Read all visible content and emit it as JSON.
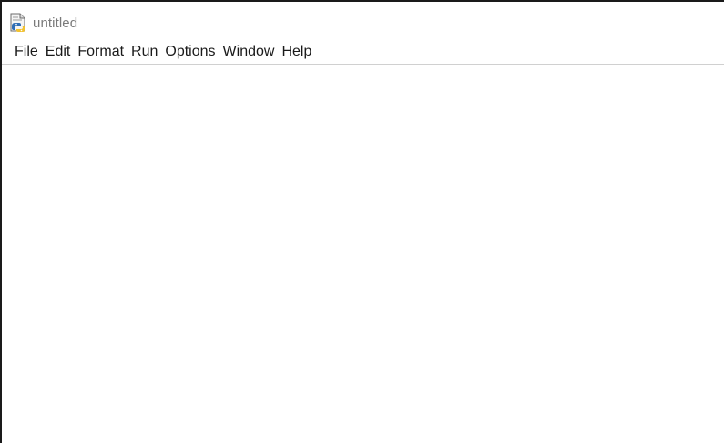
{
  "window": {
    "title": "untitled",
    "icon": "python-file-icon"
  },
  "menubar": {
    "items": [
      {
        "label": "File"
      },
      {
        "label": "Edit"
      },
      {
        "label": "Format"
      },
      {
        "label": "Run"
      },
      {
        "label": "Options"
      },
      {
        "label": "Window"
      },
      {
        "label": "Help"
      }
    ]
  },
  "editor": {
    "content": ""
  },
  "colors": {
    "title_text": "#7a7a7a",
    "menu_text": "#1a1a1a",
    "background": "#ffffff",
    "border": "#1a1a1a"
  }
}
